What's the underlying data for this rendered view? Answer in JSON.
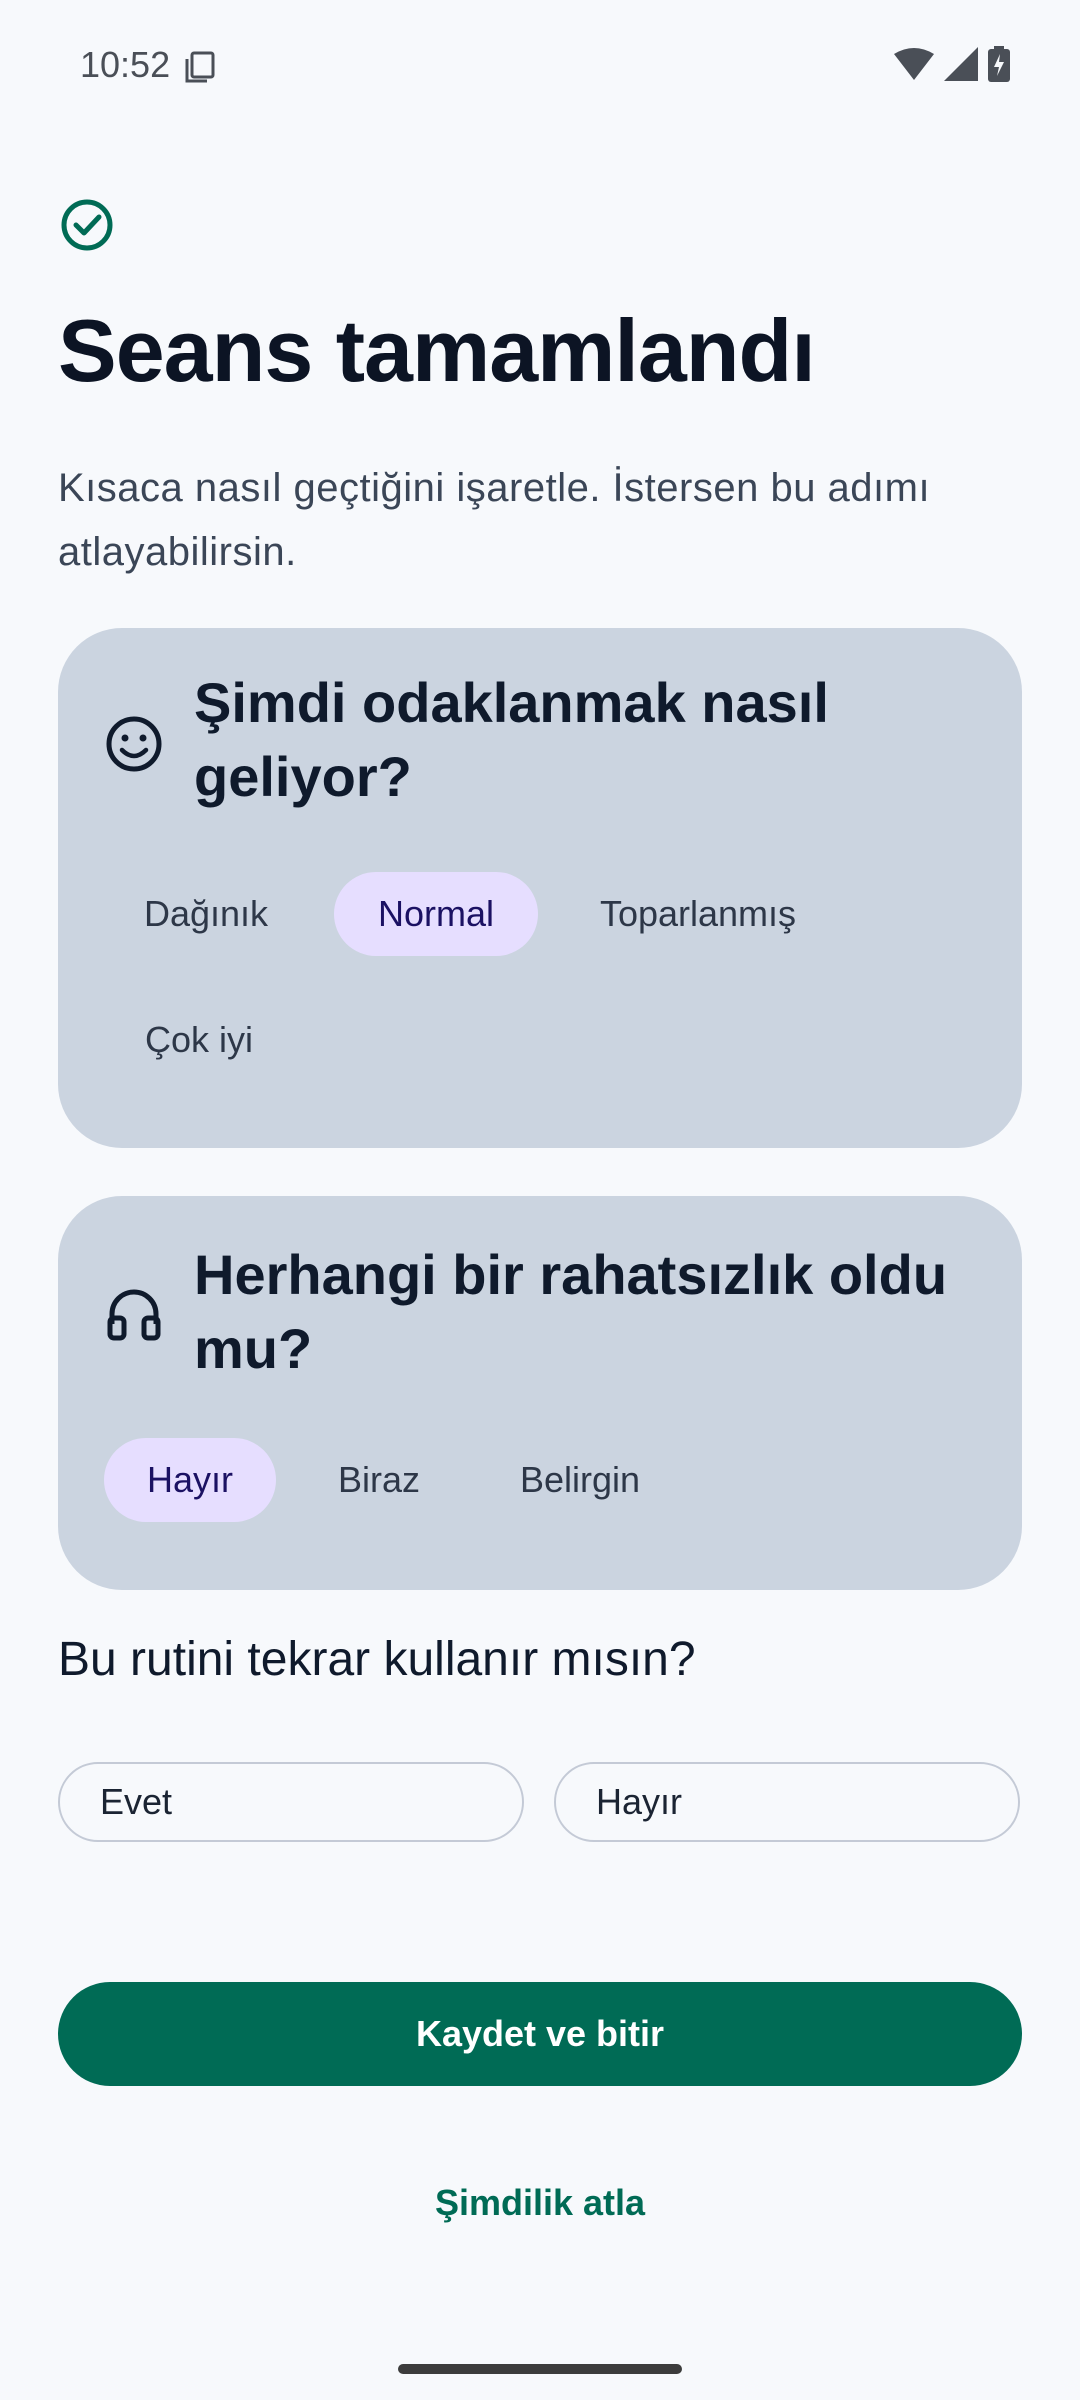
{
  "status_bar": {
    "time": "10:52"
  },
  "header": {
    "title": "Seans tamamlandı",
    "subtitle": "Kısaca nasıl geçtiğini işaretle. İstersen bu adımı atlayabilirsin."
  },
  "focus_card": {
    "title": "Şimdi odaklanmak nasıl geliyor?",
    "options": [
      "Dağınık",
      "Normal",
      "Toparlanmış",
      "Çok iyi"
    ],
    "selected": "Normal"
  },
  "distraction_card": {
    "title": "Herhangi bir rahatsızlık oldu mu?",
    "options": [
      "Hayır",
      "Biraz",
      "Belirgin"
    ],
    "selected": "Hayır"
  },
  "reuse": {
    "question": "Bu rutini tekrar kullanır mısın?",
    "yes": "Evet",
    "no": "Hayır"
  },
  "actions": {
    "save": "Kaydet ve bitir",
    "skip": "Şimdilik atla"
  },
  "colors": {
    "accent": "#006b55",
    "card": "#cbd4e0",
    "chip_selected": "#e6deff",
    "background": "#f7f9fc"
  }
}
